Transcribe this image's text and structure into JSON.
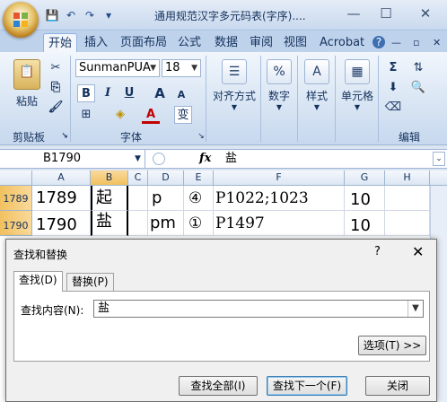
{
  "window": {
    "title": "通用规范汉字多元码表(字序)....",
    "minimize": "—",
    "maximize": "☐",
    "close": "✕"
  },
  "qat": {
    "save": "💾",
    "undo": "↶",
    "redo": "↷",
    "more": "▾"
  },
  "tabs": [
    "开始",
    "插入",
    "页面布局",
    "公式",
    "数据",
    "审阅",
    "视图",
    "Acrobat"
  ],
  "ribbon": {
    "clipboard": {
      "paste": "粘贴",
      "label": "剪贴板"
    },
    "font": {
      "name": "SunmanPUA",
      "size": "18",
      "bold": "B",
      "italic": "I",
      "underline": "U",
      "grow": "A",
      "shrink": "A",
      "wen": "变",
      "label": "字体"
    },
    "alignment": {
      "label": "对齐方式"
    },
    "number": {
      "label": "数字",
      "icon": "%"
    },
    "styles": {
      "label": "样式"
    },
    "cells": {
      "label": "单元格"
    },
    "editing": {
      "label": "编辑",
      "sum": "Σ"
    }
  },
  "formula_bar": {
    "name_box": "B1790",
    "fx": "fx",
    "value": "盐"
  },
  "sheet": {
    "columns": [
      "A",
      "B",
      "C",
      "D",
      "E",
      "F",
      "G",
      "H"
    ],
    "rows": [
      {
        "num": "1789",
        "A": "1789",
        "B": "起",
        "D": "p",
        "E": "④",
        "F": "P1022;1023",
        "G": "10"
      },
      {
        "num": "1790",
        "A": "1790",
        "B": "盐",
        "D": "pm",
        "E": "①",
        "F": "P1497",
        "G": "10"
      }
    ]
  },
  "dialog": {
    "title": "查找和替换",
    "help": "?",
    "close": "✕",
    "tabs": [
      "查找(D)",
      "替换(P)"
    ],
    "find_label": "查找内容(N):",
    "find_value": "盐",
    "options": "选项(T) >>",
    "find_all": "查找全部(I)",
    "find_next": "查找下一个(F)",
    "close_btn": "关闭"
  },
  "colors": {
    "accent": "#15325e",
    "selected_header": "#f1c15f"
  }
}
